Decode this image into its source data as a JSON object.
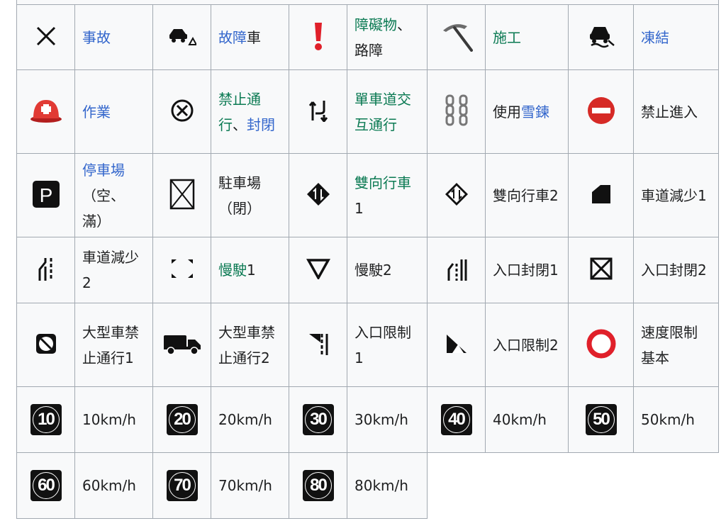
{
  "rows": [
    [
      {
        "icon": "x-mark-icon",
        "segments": [
          {
            "text": "事故",
            "style": "link"
          }
        ]
      },
      {
        "icon": "broken-car-icon",
        "segments": [
          {
            "text": "故障",
            "style": "link"
          },
          {
            "text": "車",
            "style": "plain"
          }
        ]
      },
      {
        "icon": "exclamation-icon",
        "segments": [
          {
            "text": "障礙物",
            "style": "link-green"
          },
          {
            "text": "、路障",
            "style": "plain"
          }
        ]
      },
      {
        "icon": "pickaxe-icon",
        "segments": [
          {
            "text": "施工",
            "style": "link-green"
          }
        ]
      },
      {
        "icon": "skidding-car-icon",
        "segments": [
          {
            "text": "凍結",
            "style": "link"
          }
        ]
      }
    ],
    [
      {
        "icon": "rescue-helmet-icon",
        "segments": [
          {
            "text": "作業",
            "style": "link"
          }
        ]
      },
      {
        "icon": "circled-x-icon",
        "segments": [
          {
            "text": "禁止通行",
            "style": "link-green"
          },
          {
            "text": "、",
            "style": "plain"
          },
          {
            "text": "封閉",
            "style": "link"
          }
        ]
      },
      {
        "icon": "alternating-lanes-icon",
        "segments": [
          {
            "text": "單車道交互通行",
            "style": "link-green"
          }
        ]
      },
      {
        "icon": "chains-icon",
        "segments": [
          {
            "text": "使用",
            "style": "plain"
          },
          {
            "text": "雪鍊",
            "style": "link"
          }
        ]
      },
      {
        "icon": "no-entry-icon",
        "segments": [
          {
            "text": "禁止進入",
            "style": "plain"
          }
        ]
      }
    ],
    [
      {
        "icon": "parking-icon",
        "segments": [
          {
            "text": "停車場",
            "style": "link"
          },
          {
            "text": "（空、滿）",
            "style": "plain"
          }
        ]
      },
      {
        "icon": "parking-closed-icon",
        "segments": [
          {
            "text": "駐車場（閉）",
            "style": "plain"
          }
        ]
      },
      {
        "icon": "two-way-traffic-1-icon",
        "segments": [
          {
            "text": "雙向行車",
            "style": "link-green"
          },
          {
            "text": "1",
            "style": "plain"
          }
        ]
      },
      {
        "icon": "two-way-traffic-2-icon",
        "segments": [
          {
            "text": "雙向行車2",
            "style": "plain"
          }
        ]
      },
      {
        "icon": "lane-reduction-1-icon",
        "segments": [
          {
            "text": "車道減少1",
            "style": "plain"
          }
        ]
      }
    ],
    [
      {
        "icon": "lane-reduction-2-icon",
        "segments": [
          {
            "text": "車道減少2",
            "style": "plain"
          }
        ]
      },
      {
        "icon": "slow-down-1-icon",
        "segments": [
          {
            "text": "慢駛",
            "style": "link-green"
          },
          {
            "text": "1",
            "style": "plain"
          }
        ]
      },
      {
        "icon": "slow-down-2-icon",
        "segments": [
          {
            "text": "慢駛2",
            "style": "plain"
          }
        ]
      },
      {
        "icon": "entrance-closed-1-icon",
        "segments": [
          {
            "text": "入口封閉1",
            "style": "plain"
          }
        ]
      },
      {
        "icon": "entrance-closed-2-icon",
        "segments": [
          {
            "text": "入口封閉2",
            "style": "plain"
          }
        ]
      }
    ],
    [
      {
        "icon": "no-large-vehicles-1-icon",
        "segments": [
          {
            "text": "大型車禁止通行1",
            "style": "plain"
          }
        ]
      },
      {
        "icon": "truck-icon",
        "segments": [
          {
            "text": "大型車禁止通行2",
            "style": "plain"
          }
        ]
      },
      {
        "icon": "entrance-restriction-1-icon",
        "segments": [
          {
            "text": "入口限制1",
            "style": "plain"
          }
        ]
      },
      {
        "icon": "entrance-restriction-2-icon",
        "segments": [
          {
            "text": "入口限制2",
            "style": "plain"
          }
        ]
      },
      {
        "icon": "speed-limit-ring-icon",
        "segments": [
          {
            "text": "速度限制基本",
            "style": "plain"
          }
        ]
      }
    ],
    [
      {
        "icon": "speed-10-icon",
        "speed": "10",
        "segments": [
          {
            "text": "10km/h",
            "style": "plain"
          }
        ]
      },
      {
        "icon": "speed-20-icon",
        "speed": "20",
        "segments": [
          {
            "text": "20km/h",
            "style": "plain"
          }
        ]
      },
      {
        "icon": "speed-30-icon",
        "speed": "30",
        "segments": [
          {
            "text": "30km/h",
            "style": "plain"
          }
        ]
      },
      {
        "icon": "speed-40-icon",
        "speed": "40",
        "segments": [
          {
            "text": "40km/h",
            "style": "plain"
          }
        ]
      },
      {
        "icon": "speed-50-icon",
        "speed": "50",
        "segments": [
          {
            "text": "50km/h",
            "style": "plain"
          }
        ]
      }
    ],
    [
      {
        "icon": "speed-60-icon",
        "speed": "60",
        "segments": [
          {
            "text": "60km/h",
            "style": "plain"
          }
        ]
      },
      {
        "icon": "speed-70-icon",
        "speed": "70",
        "segments": [
          {
            "text": "70km/h",
            "style": "plain"
          }
        ]
      },
      {
        "icon": "speed-80-icon",
        "speed": "80",
        "segments": [
          {
            "text": "80km/h",
            "style": "plain"
          }
        ]
      }
    ]
  ]
}
